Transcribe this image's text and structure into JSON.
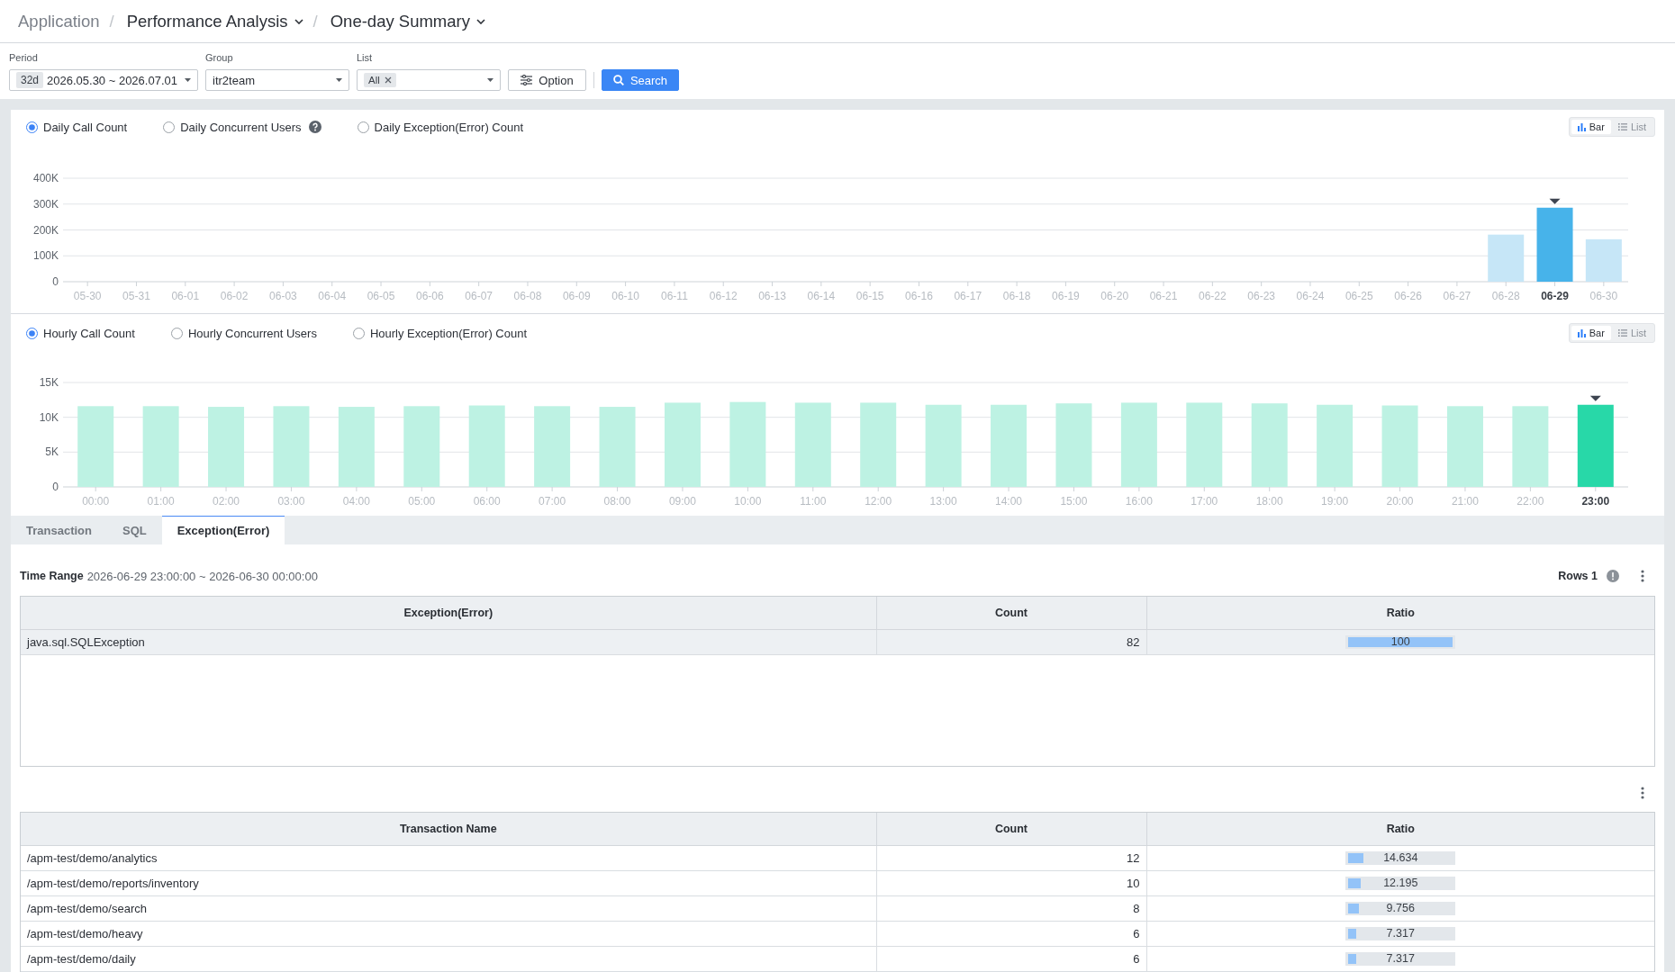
{
  "breadcrumb": [
    {
      "label": "Application",
      "dropdown": false
    },
    {
      "separator": "/",
      "label": "Performance Analysis",
      "dropdown": true
    },
    {
      "separator": "/",
      "label": "One-day Summary",
      "dropdown": true
    }
  ],
  "filters": {
    "fields": [
      {
        "kind": "period",
        "label": "Period",
        "badge": "32d",
        "value": "2026.05.30 ~ 2026.07.01"
      },
      {
        "kind": "select",
        "label": "Group",
        "value": "itr2team"
      },
      {
        "kind": "tags",
        "label": "List",
        "tags": [
          "All"
        ]
      }
    ],
    "buttons": [
      {
        "kind": "option",
        "label": "Option"
      },
      {
        "kind": "search",
        "label": "Search"
      }
    ]
  },
  "daily_panel": {
    "options": [
      {
        "label": "Daily Call Count",
        "selected": true,
        "help": false
      },
      {
        "label": "Daily Concurrent Users",
        "selected": false,
        "help": true
      },
      {
        "label": "Daily Exception(Error) Count",
        "selected": false,
        "help": false
      }
    ],
    "views": [
      {
        "kind": "bar",
        "label": "Bar",
        "selected": true
      },
      {
        "kind": "list",
        "label": "List",
        "selected": false
      }
    ],
    "chart_data": {
      "type": "bar",
      "stacked": true,
      "grid": true,
      "categories": [
        "05-30",
        "05-31",
        "06-01",
        "06-02",
        "06-03",
        "06-04",
        "06-05",
        "06-06",
        "06-07",
        "06-08",
        "06-09",
        "06-10",
        "06-11",
        "06-12",
        "06-13",
        "06-14",
        "06-15",
        "06-16",
        "06-17",
        "06-18",
        "06-19",
        "06-20",
        "06-21",
        "06-22",
        "06-23",
        "06-24",
        "06-25",
        "06-26",
        "06-27",
        "06-28",
        "06-29",
        "06-30"
      ],
      "series": [
        {
          "color": "#c6e6f7",
          "values": [
            0,
            0,
            0,
            0,
            0,
            0,
            0,
            0,
            0,
            0,
            0,
            0,
            0,
            0,
            0,
            0,
            0,
            0,
            0,
            0,
            0,
            0,
            0,
            0,
            0,
            0,
            0,
            0,
            0,
            182000,
            0,
            164000
          ]
        },
        {
          "color": "#47b3ea",
          "values": [
            0,
            0,
            0,
            0,
            0,
            0,
            0,
            0,
            0,
            0,
            0,
            0,
            0,
            0,
            0,
            0,
            0,
            0,
            0,
            0,
            0,
            0,
            0,
            0,
            0,
            0,
            0,
            0,
            0,
            0,
            286000,
            0
          ]
        }
      ],
      "ylim": [
        0,
        400000
      ],
      "yticks": [
        {
          "value": 0,
          "label": "0"
        },
        {
          "value": 100000,
          "label": "100K"
        },
        {
          "value": 200000,
          "label": "200K"
        },
        {
          "value": 300000,
          "label": "300K"
        },
        {
          "value": 400000,
          "label": "400K"
        }
      ]
    }
  },
  "hourly_panel": {
    "options": [
      {
        "label": "Hourly Call Count",
        "selected": true,
        "help": false
      },
      {
        "label": "Hourly Concurrent Users",
        "selected": false,
        "help": false
      },
      {
        "label": "Hourly Exception(Error) Count",
        "selected": false,
        "help": false
      }
    ],
    "views": [
      {
        "kind": "bar",
        "label": "Bar",
        "selected": true
      },
      {
        "kind": "list",
        "label": "List",
        "selected": false
      }
    ],
    "chart_data": {
      "type": "bar",
      "stacked": true,
      "grid": true,
      "categories": [
        "00:00",
        "01:00",
        "02:00",
        "03:00",
        "04:00",
        "05:00",
        "06:00",
        "07:00",
        "08:00",
        "09:00",
        "10:00",
        "11:00",
        "12:00",
        "13:00",
        "14:00",
        "15:00",
        "16:00",
        "17:00",
        "18:00",
        "19:00",
        "20:00",
        "21:00",
        "22:00",
        "23:00"
      ],
      "series": [
        {
          "color": "#bdf2e3",
          "values": [
            11600,
            11600,
            11500,
            11600,
            11500,
            11600,
            11700,
            11600,
            11500,
            12100,
            12200,
            12100,
            12100,
            11800,
            11800,
            12000,
            12100,
            12100,
            12000,
            11800,
            11700,
            11600,
            11600,
            0
          ]
        },
        {
          "color": "#28d8a8",
          "values": [
            0,
            0,
            0,
            0,
            0,
            0,
            0,
            0,
            0,
            0,
            0,
            0,
            0,
            0,
            0,
            0,
            0,
            0,
            0,
            0,
            0,
            0,
            0,
            11800
          ]
        }
      ],
      "ylim": [
        0,
        15000
      ],
      "yticks": [
        {
          "value": 0,
          "label": "0"
        },
        {
          "value": 5000,
          "label": "5K"
        },
        {
          "value": 10000,
          "label": "10K"
        },
        {
          "value": 15000,
          "label": "15K"
        }
      ]
    }
  },
  "tabs": [
    {
      "label": "Transaction",
      "selected": false
    },
    {
      "label": "SQL",
      "selected": false
    },
    {
      "label": "Exception(Error)",
      "selected": true
    }
  ],
  "exception_table": {
    "time_range_label": "Time Range",
    "time_range": "2026-06-29 23:00:00 ~ 2026-06-30 00:00:00",
    "rows_count": "Rows 1",
    "columns": [
      "Exception(Error)",
      "Count",
      "Ratio"
    ],
    "rows": [
      {
        "name": "java.sql.SQLException",
        "count": "82",
        "ratio": "100",
        "level": 1,
        "selected": true
      }
    ]
  },
  "transaction_table": {
    "columns": [
      "Transaction Name",
      "Count",
      "Ratio"
    ],
    "rows": [
      {
        "name": "/apm-test/demo/analytics",
        "count": "12",
        "ratio": "14.634",
        "level": 0.14634,
        "selected": false
      },
      {
        "name": "/apm-test/demo/reports/inventory",
        "count": "10",
        "ratio": "12.195",
        "level": 0.12195,
        "selected": false
      },
      {
        "name": "/apm-test/demo/search",
        "count": "8",
        "ratio": "9.756",
        "level": 0.09756,
        "selected": false
      },
      {
        "name": "/apm-test/demo/heavy",
        "count": "6",
        "ratio": "7.317",
        "level": 0.07317,
        "selected": false
      },
      {
        "name": "/apm-test/demo/daily",
        "count": "6",
        "ratio": "7.317",
        "level": 0.07317,
        "selected": false
      }
    ]
  }
}
